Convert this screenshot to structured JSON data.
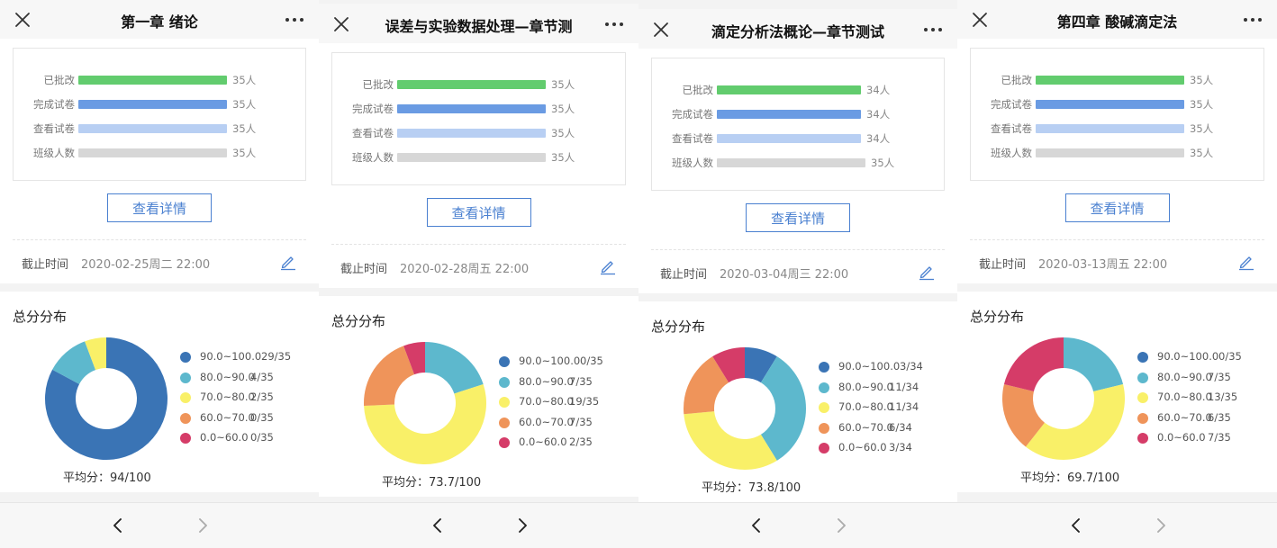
{
  "colors": {
    "bars": [
      "#62cc6e",
      "#6a9be3",
      "#b8cff3",
      "#d7d7d7"
    ],
    "segments": [
      "#3a74b5",
      "#5db8cd",
      "#f9f068",
      "#ef945a",
      "#d53c68"
    ],
    "accent": "#4a80d0"
  },
  "icons": {
    "close": "close-icon",
    "more": "more-icon",
    "edit": "edit-icon",
    "prev": "chevron-left-icon",
    "next": "chevron-right-icon"
  },
  "panels": [
    {
      "title": "第一章 绪论",
      "bars": [
        {
          "label": "已批改",
          "count": "35人",
          "value": 35
        },
        {
          "label": "完成试卷",
          "count": "35人",
          "value": 35
        },
        {
          "label": "查看试卷",
          "count": "35人",
          "value": 35
        },
        {
          "label": "班级人数",
          "count": "35人",
          "value": 35
        }
      ],
      "bar_max": 35,
      "detail_button": "查看详情",
      "deadline_label": "截止时间",
      "deadline_value": "2020-02-25周二 22:00",
      "distribution_title": "总分分布",
      "segments": [
        {
          "range": "90.0~100.0",
          "count": "29/35",
          "value": 29
        },
        {
          "range": "80.0~90.0",
          "count": "4/35",
          "value": 4
        },
        {
          "range": "70.0~80.0",
          "count": "2/35",
          "value": 2
        },
        {
          "range": "60.0~70.0",
          "count": "0/35",
          "value": 0
        },
        {
          "range": "0.0~60.0",
          "count": "0/35",
          "value": 0
        }
      ],
      "average_label": "平均分：",
      "average_value": "94/100"
    },
    {
      "title": "误差与实验数据处理—章节测",
      "bars": [
        {
          "label": "已批改",
          "count": "35人",
          "value": 35
        },
        {
          "label": "完成试卷",
          "count": "35人",
          "value": 35
        },
        {
          "label": "查看试卷",
          "count": "35人",
          "value": 35
        },
        {
          "label": "班级人数",
          "count": "35人",
          "value": 35
        }
      ],
      "bar_max": 35,
      "detail_button": "查看详情",
      "deadline_label": "截止时间",
      "deadline_value": "2020-02-28周五 22:00",
      "distribution_title": "总分分布",
      "segments": [
        {
          "range": "90.0~100.0",
          "count": "0/35",
          "value": 0
        },
        {
          "range": "80.0~90.0",
          "count": "7/35",
          "value": 7
        },
        {
          "range": "70.0~80.0",
          "count": "19/35",
          "value": 19
        },
        {
          "range": "60.0~70.0",
          "count": "7/35",
          "value": 7
        },
        {
          "range": "0.0~60.0",
          "count": "2/35",
          "value": 2
        }
      ],
      "average_label": "平均分：",
      "average_value": "73.7/100"
    },
    {
      "title": "滴定分析法概论—章节测试",
      "bars": [
        {
          "label": "已批改",
          "count": "34人",
          "value": 34
        },
        {
          "label": "完成试卷",
          "count": "34人",
          "value": 34
        },
        {
          "label": "查看试卷",
          "count": "34人",
          "value": 34
        },
        {
          "label": "班级人数",
          "count": "35人",
          "value": 35
        }
      ],
      "bar_max": 35,
      "detail_button": "查看详情",
      "deadline_label": "截止时间",
      "deadline_value": "2020-03-04周三 22:00",
      "distribution_title": "总分分布",
      "segments": [
        {
          "range": "90.0~100.0",
          "count": "3/34",
          "value": 3
        },
        {
          "range": "80.0~90.0",
          "count": "11/34",
          "value": 11
        },
        {
          "range": "70.0~80.0",
          "count": "11/34",
          "value": 11
        },
        {
          "range": "60.0~70.0",
          "count": "6/34",
          "value": 6
        },
        {
          "range": "0.0~60.0",
          "count": "3/34",
          "value": 3
        }
      ],
      "average_label": "平均分：",
      "average_value": "73.8/100"
    },
    {
      "title": "第四章 酸碱滴定法",
      "bars": [
        {
          "label": "已批改",
          "count": "35人",
          "value": 35
        },
        {
          "label": "完成试卷",
          "count": "35人",
          "value": 35
        },
        {
          "label": "查看试卷",
          "count": "35人",
          "value": 35
        },
        {
          "label": "班级人数",
          "count": "35人",
          "value": 35
        }
      ],
      "bar_max": 35,
      "detail_button": "查看详情",
      "deadline_label": "截止时间",
      "deadline_value": "2020-03-13周五 22:00",
      "distribution_title": "总分分布",
      "segments": [
        {
          "range": "90.0~100.0",
          "count": "0/35",
          "value": 0
        },
        {
          "range": "80.0~90.0",
          "count": "7/35",
          "value": 7
        },
        {
          "range": "70.0~80.0",
          "count": "13/35",
          "value": 13
        },
        {
          "range": "60.0~70.0",
          "count": "6/35",
          "value": 6
        },
        {
          "range": "0.0~60.0",
          "count": "7/35",
          "value": 7
        }
      ],
      "average_label": "平均分：",
      "average_value": "69.7/100"
    }
  ]
}
